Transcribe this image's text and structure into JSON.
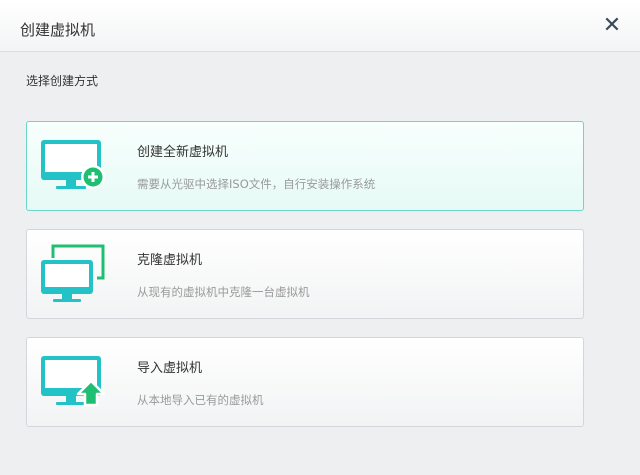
{
  "dialog": {
    "title": "创建虚拟机",
    "close_glyph": "✕"
  },
  "section": {
    "label": "选择创建方式"
  },
  "options": [
    {
      "title": "创建全新虚拟机",
      "description": "需要从光驱中选择ISO文件，自行安装操作系统",
      "icon": "monitor-plus-icon",
      "selected": true
    },
    {
      "title": "克隆虚拟机",
      "description": "从现有的虚拟机中克隆一台虚拟机",
      "icon": "monitor-clone-icon",
      "selected": false
    },
    {
      "title": "导入虚拟机",
      "description": "从本地导入已有的虚拟机",
      "icon": "monitor-import-icon",
      "selected": false
    }
  ],
  "colors": {
    "accent_teal": "#23c2c6",
    "accent_green": "#1fbf73",
    "selected_border": "#6ed6c4"
  }
}
